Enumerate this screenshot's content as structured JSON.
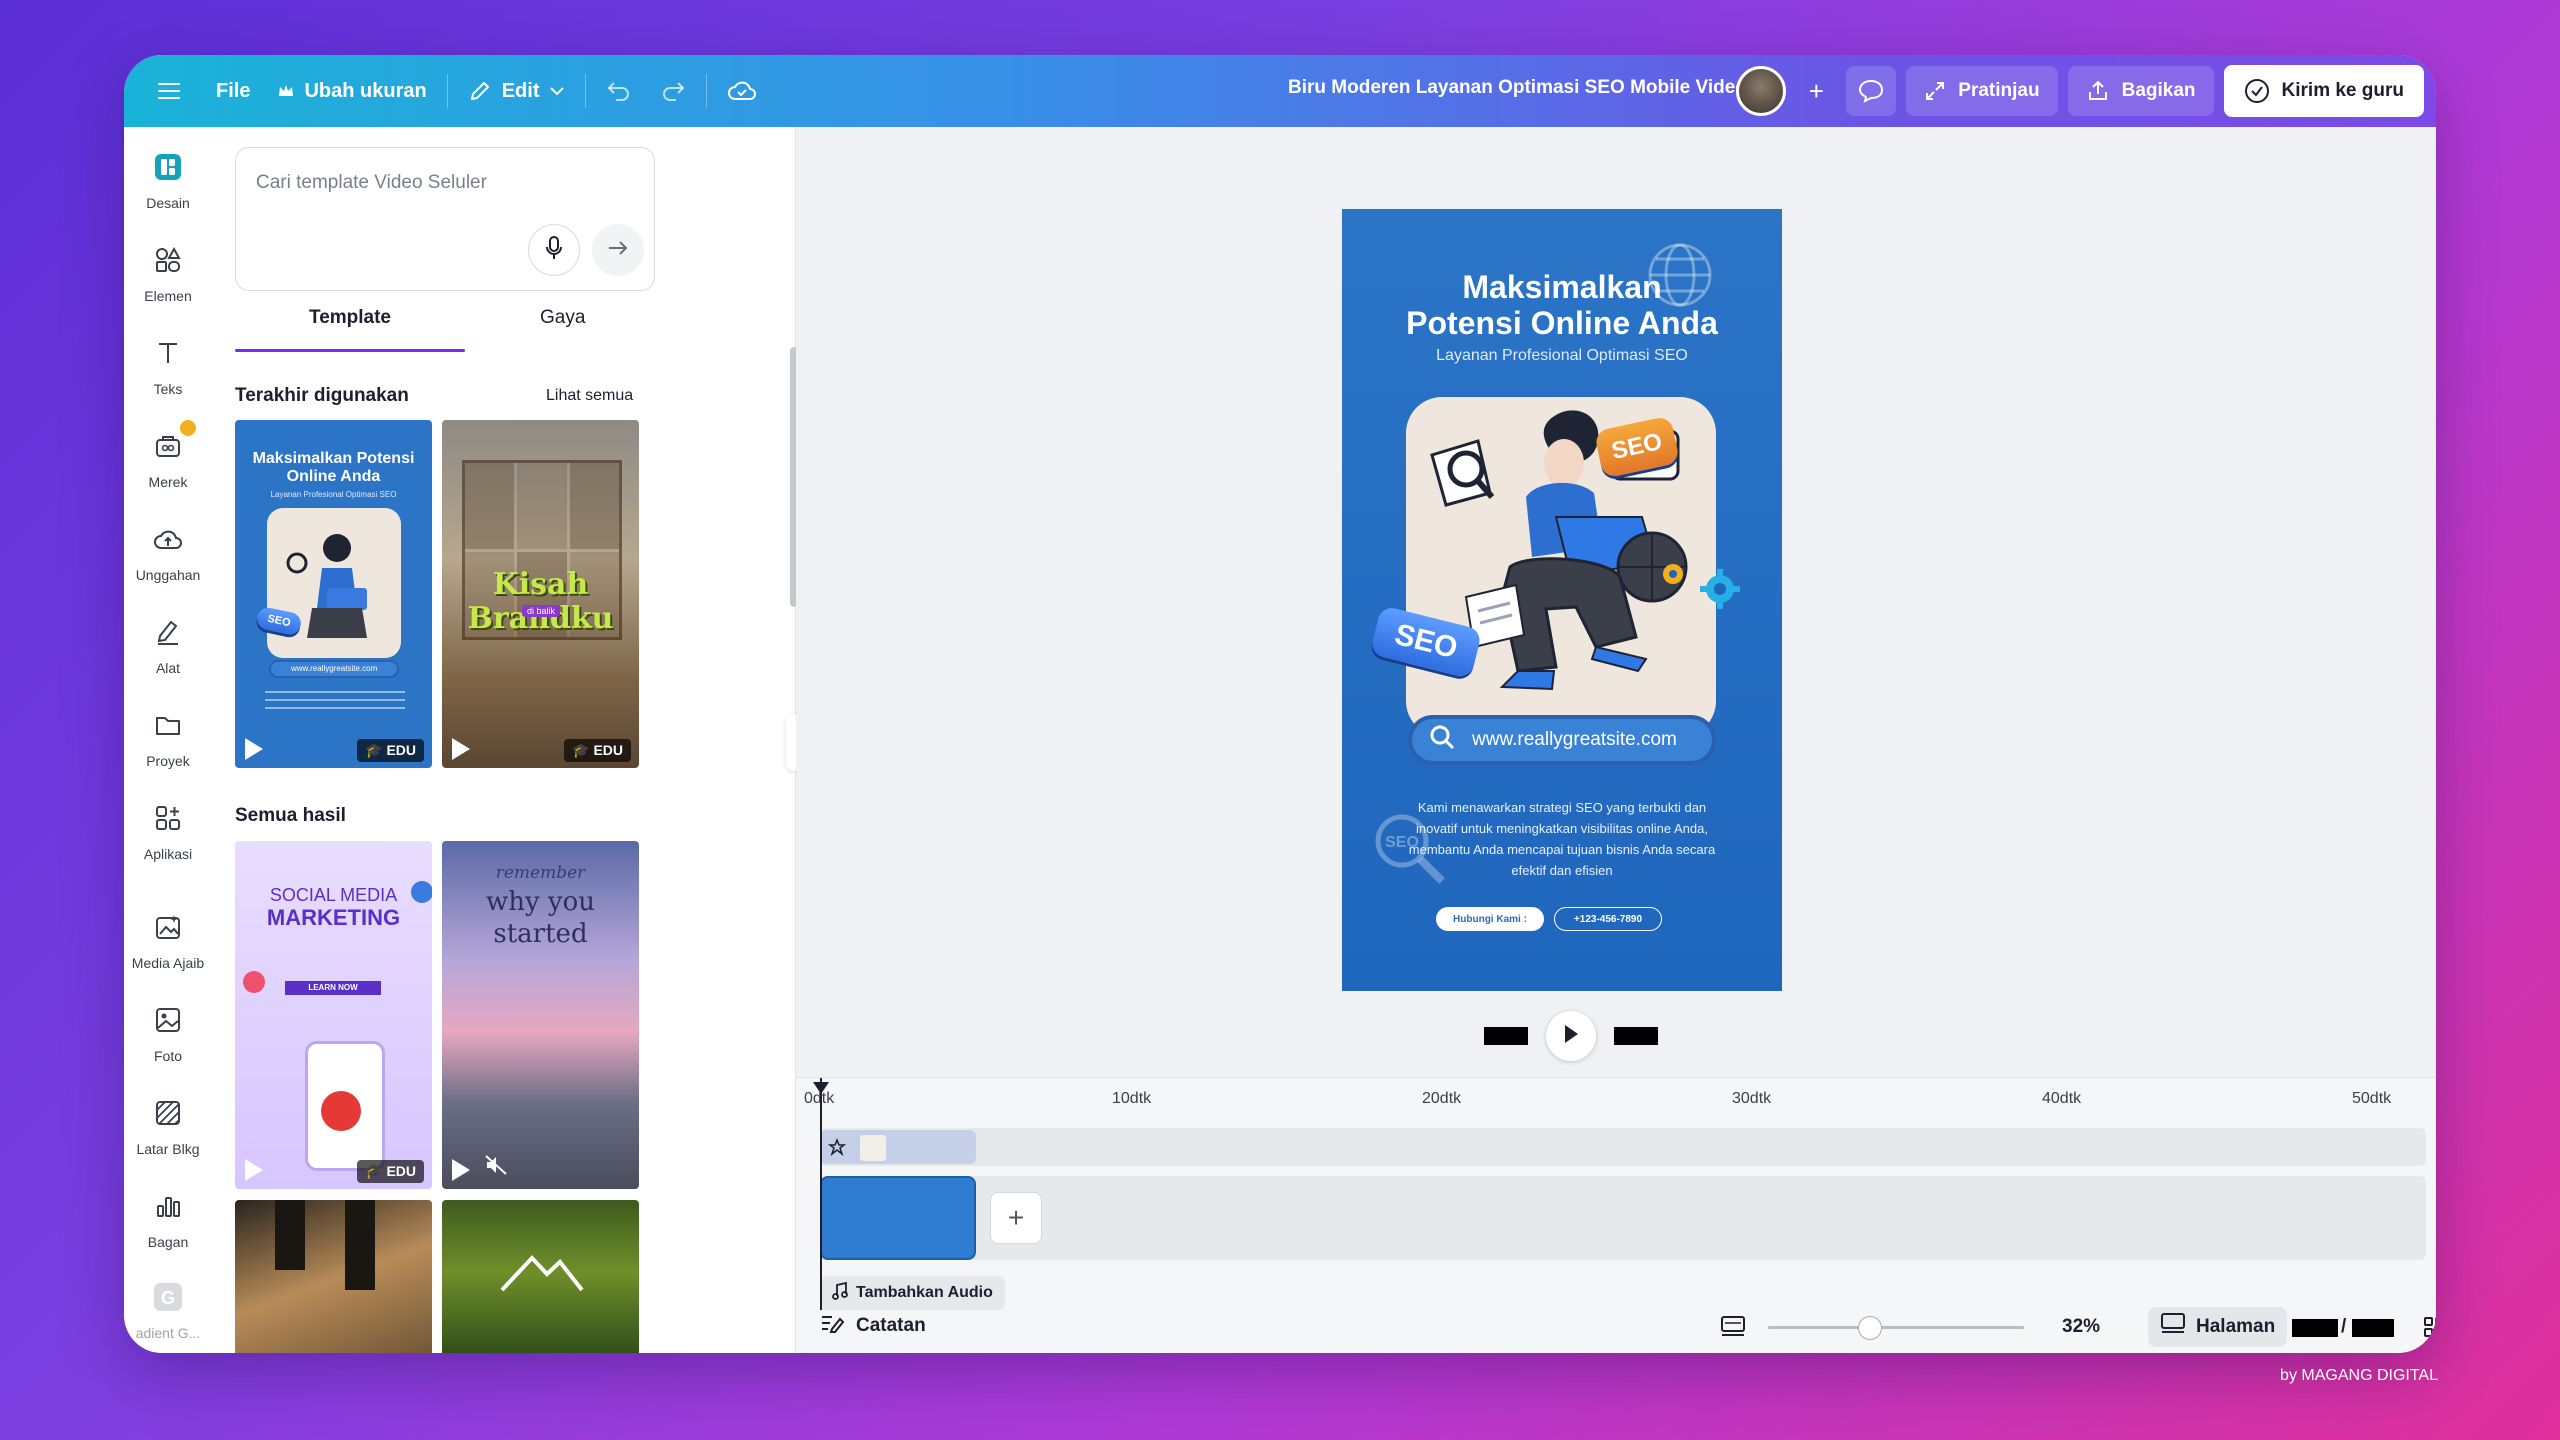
{
  "topbar": {
    "file_label": "File",
    "resize_label": "Ubah ukuran",
    "edit_label": "Edit",
    "doc_title": "Biru Moderen Layanan Optimasi SEO Mobile Video",
    "preview_label": "Pratinjau",
    "share_label": "Bagikan",
    "send_label": "Kirim ke guru"
  },
  "sidebar": {
    "items": [
      {
        "label": "Desain",
        "icon": "design-icon"
      },
      {
        "label": "Elemen",
        "icon": "elements-icon"
      },
      {
        "label": "Teks",
        "icon": "text-icon"
      },
      {
        "label": "Merek",
        "icon": "brand-icon"
      },
      {
        "label": "Unggahan",
        "icon": "upload-icon"
      },
      {
        "label": "Alat",
        "icon": "tools-icon"
      },
      {
        "label": "Proyek",
        "icon": "folder-icon"
      },
      {
        "label": "Aplikasi",
        "icon": "apps-icon"
      },
      {
        "label": "Media Ajaib",
        "icon": "magic-media-icon"
      },
      {
        "label": "Foto",
        "icon": "photo-icon"
      },
      {
        "label": "Latar Blkg",
        "icon": "background-icon"
      },
      {
        "label": "Bagan",
        "icon": "chart-icon"
      },
      {
        "label": "adient G...",
        "icon": "gradient-icon"
      }
    ]
  },
  "panel": {
    "search_placeholder": "Cari template Video Seluler",
    "tab_template": "Template",
    "tab_style": "Gaya",
    "recent_title": "Terakhir digunakan",
    "see_all": "Lihat semua",
    "all_results_title": "Semua hasil",
    "badge_edu": "EDU",
    "thumbs": {
      "t1_title": "Maksimalkan Potensi Online Anda",
      "t1_sub": "Layanan Profesional Optimasi SEO",
      "t1_url": "www.reallygreatsite.com",
      "t1_tag": "SEO",
      "t2_title": "Kisah Brandku",
      "t2_small": "di balik",
      "t3_title1": "SOCIAL MEDIA",
      "t3_title2": "MARKETING",
      "t3_btn": "LEARN NOW",
      "t4_l1": "remember",
      "t4_l2": "why you",
      "t4_l3": "started"
    }
  },
  "poster": {
    "title_line1": "Maksimalkan",
    "title_line2": "Potensi Online Anda",
    "subtitle": "Layanan Profesional Optimasi SEO",
    "url": "www.reallygreatsite.com",
    "description": "Kami menawarkan strategi SEO yang terbukti dan inovatif untuk meningkatkan visibilitas online Anda, membantu Anda mencapai tujuan bisnis Anda secara efektif dan efisien",
    "btn_contact": "Hubungi Kami :",
    "btn_phone": "+123-456-7890",
    "tag_seo": "SEO",
    "globe_text": "SEO"
  },
  "timeline": {
    "ticks": [
      "0dtk",
      "10dtk",
      "20dtk",
      "30dtk",
      "40dtk",
      "50dtk"
    ],
    "add_audio": "Tambahkan Audio"
  },
  "bottombar": {
    "notes_label": "Catatan",
    "zoom": "32%",
    "zoom_fraction": 0.32,
    "page_label": "Halaman",
    "page_sep": "/"
  },
  "credit": "by MAGANG DIGITAL",
  "colors": {
    "accent": "#7d2ae8",
    "poster_blue": "#2b74c6"
  }
}
